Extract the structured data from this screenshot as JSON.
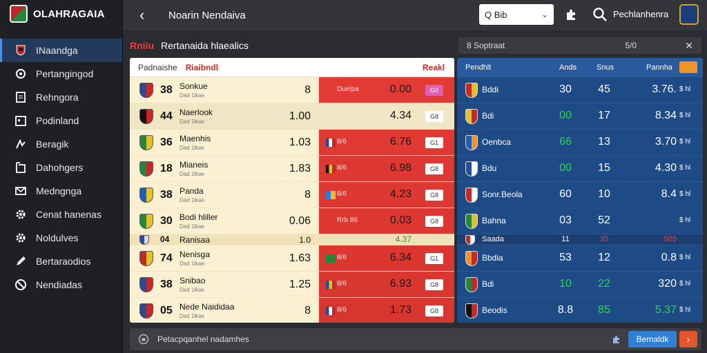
{
  "app": {
    "title": "OLAHRAGAIA"
  },
  "sidebar": {
    "items": [
      {
        "label": "INaandga",
        "icon": "team-crest-icon",
        "active": true
      },
      {
        "label": "Pertangingod",
        "icon": "settings-icon",
        "active": false
      },
      {
        "label": "Rehngora",
        "icon": "document-icon",
        "active": false
      },
      {
        "label": "Podinland",
        "icon": "calendar-icon",
        "active": false
      },
      {
        "label": "Beragik",
        "icon": "chart-icon",
        "active": false
      },
      {
        "label": "Dahohgers",
        "icon": "book-icon",
        "active": false
      },
      {
        "label": "Medngnga",
        "icon": "mail-icon",
        "active": false
      },
      {
        "label": "Cenat hanenas",
        "icon": "gear-icon",
        "active": false
      },
      {
        "label": "Noldulves",
        "icon": "gear-icon",
        "active": false
      },
      {
        "label": "Bertaraodios",
        "icon": "pencil-icon",
        "active": false
      },
      {
        "label": "Nendiadas",
        "icon": "ban-icon",
        "active": false
      }
    ]
  },
  "topbar": {
    "title": "Noarin Nendaiva",
    "select_value": "Q Bib",
    "user_label": "Pechlanhenra"
  },
  "section": {
    "highlight": "Rniiu",
    "title": "Rertanaida hlaealics"
  },
  "right_header": {
    "left": "8 Soptraat",
    "mid": "5/0"
  },
  "left_table": {
    "head_left": "Padnaishe",
    "head_mid": "Riaibndl",
    "head_right": "Reakl",
    "rows": [
      {
        "num": "38",
        "team": "Sonkue",
        "sub": "Dad 1lkae",
        "odds": "8",
        "flag": "",
        "tag": "Duelpa",
        "rval": "0.00",
        "btn": "G0",
        "btn_pink": true,
        "crest": [
          "#2a4a9a",
          "#c62828"
        ]
      },
      {
        "num": "44",
        "team": "Naerlook",
        "sub": "Dad 1lkae",
        "odds": "1.00",
        "flag": "",
        "tag": "8/6",
        "rval": "4.34",
        "btn": "G8",
        "btn_pink": false,
        "crest": [
          "#111",
          "#c62828"
        ],
        "hl": true
      },
      {
        "num": "36",
        "team": "Maenhis",
        "sub": "Dad 1lkae",
        "odds": "1.03",
        "flag": "fr",
        "tag": "8/6",
        "rval": "6.76",
        "btn": "G1",
        "btn_pink": false,
        "crest": [
          "#1f8a3c",
          "#e2c12a"
        ]
      },
      {
        "num": "18",
        "team": "Mianeis",
        "sub": "Dad 1lkae",
        "odds": "1.83",
        "flag": "be",
        "tag": "8/6",
        "rval": "6.98",
        "btn": "G8",
        "btn_pink": false,
        "crest": [
          "#1f8a3c",
          "#c62828"
        ]
      },
      {
        "num": "38",
        "team": "Panda",
        "sub": "Dad 1lkae",
        "odds": "8",
        "flag": "sw",
        "tag": "8/6",
        "rval": "4.23",
        "btn": "G8",
        "btn_pink": false,
        "crest": [
          "#1b5ec2",
          "#e2c12a"
        ]
      },
      {
        "num": "30",
        "team": "Bodi hliller",
        "sub": "Dad 1lkae",
        "odds": "0.06",
        "flag": "",
        "tag": "Rrb 86",
        "rval": "0.03",
        "btn": "G8",
        "btn_pink": false,
        "crest": [
          "#1f8a3c",
          "#e2c12a"
        ]
      },
      {
        "num": "04",
        "team": "Ranisaa",
        "sub": "",
        "odds": "1.0",
        "flag": "",
        "tag": "",
        "rval": "4.37",
        "btn": "",
        "btn_pink": false,
        "crest": [
          "#2a4a9a",
          "#ddd"
        ],
        "thin": true
      },
      {
        "num": "74",
        "team": "Nenisga",
        "sub": "Dad 1lkae",
        "odds": "1.63",
        "flag": "gr",
        "tag": "8/6",
        "rval": "6.34",
        "btn": "G1",
        "btn_pink": false,
        "crest": [
          "#c62828",
          "#e2c12a"
        ]
      },
      {
        "num": "38",
        "team": "Snibao",
        "sub": "Dad 1lkae",
        "odds": "1.25",
        "flag": "ro",
        "tag": "8/6",
        "rval": "6.93",
        "btn": "G8",
        "btn_pink": false,
        "crest": [
          "#2a4a9a",
          "#c62828"
        ]
      },
      {
        "num": "05",
        "team": "Nede Naididaa",
        "sub": "Dad 1lkae",
        "odds": "8",
        "flag": "fr",
        "tag": "8/6",
        "rval": "1.73",
        "btn": "G8",
        "btn_pink": false,
        "crest": [
          "#2a4a9a",
          "#c62828"
        ]
      }
    ]
  },
  "right_table": {
    "head": [
      "Pendhlt",
      "Ands",
      "Snus",
      "Pannha"
    ],
    "rows": [
      {
        "team": "Bddi",
        "c1": "30",
        "c2": "45",
        "c3": "3.76.",
        "c4": "$ hl",
        "c1c": "",
        "c2c": "",
        "c3c": "",
        "crest": [
          "#c62828",
          "#e2c12a"
        ]
      },
      {
        "team": "Bdi",
        "c1": "00",
        "c2": "17",
        "c3": "8.34",
        "c4": "$ hl",
        "c1c": "green",
        "c2c": "",
        "c3c": "",
        "crest": [
          "#e2c12a",
          "#c62828"
        ]
      },
      {
        "team": "Oenbca",
        "c1": "66",
        "c2": "13",
        "c3": "3.70",
        "c4": "$ hl",
        "c1c": "green",
        "c2c": "",
        "c3c": "",
        "crest": [
          "#1b5ec2",
          "#f0932b"
        ]
      },
      {
        "team": "Bdu",
        "c1": "00",
        "c2": "15",
        "c3": "4.30",
        "c4": "$ hl",
        "c1c": "green",
        "c2c": "",
        "c3c": "",
        "crest": [
          "#2a4a9a",
          "#fff"
        ]
      },
      {
        "team": "Sonr.Beola",
        "c1": "60",
        "c2": "10",
        "c3": "8.4",
        "c4": "$ hl",
        "c1c": "",
        "c2c": "",
        "c3c": "",
        "crest": [
          "#c62828",
          "#fff"
        ]
      },
      {
        "team": "Bahna",
        "c1": "03",
        "c2": "52",
        "c3": "",
        "c4": "$ hl",
        "c1c": "",
        "c2c": "",
        "c3c": "",
        "crest": [
          "#1f8a3c",
          "#e2c12a"
        ]
      },
      {
        "team": "Saada",
        "c1": "11",
        "c2": "35",
        "c3": "505",
        "c4": "",
        "c1c": "",
        "c2c": "red",
        "c3c": "red",
        "crest": [
          "#c62828",
          "#fff"
        ],
        "thin": true
      },
      {
        "team": "Bbdia",
        "c1": "53",
        "c2": "12",
        "c3": "0.8",
        "c4": "$ hl",
        "c1c": "",
        "c2c": "",
        "c3c": "",
        "crest": [
          "#f0932b",
          "#c62828"
        ]
      },
      {
        "team": "Bdi",
        "c1": "10",
        "c2": "22",
        "c3": "320",
        "c4": "$ hl",
        "c1c": "green",
        "c2c": "green",
        "c3c": "",
        "crest": [
          "#1f8a3c",
          "#c62828"
        ]
      },
      {
        "team": "Beodis",
        "c1": "8.8",
        "c2": "85",
        "c3": "5.37",
        "c4": "$ hl",
        "c1c": "",
        "c2c": "green",
        "c3c": "green",
        "crest": [
          "#111",
          "#c62828"
        ]
      }
    ]
  },
  "bottom": {
    "text": "Petacpqanhel nadamhes",
    "button_label": "Bemaldk",
    "go_label": "›"
  }
}
